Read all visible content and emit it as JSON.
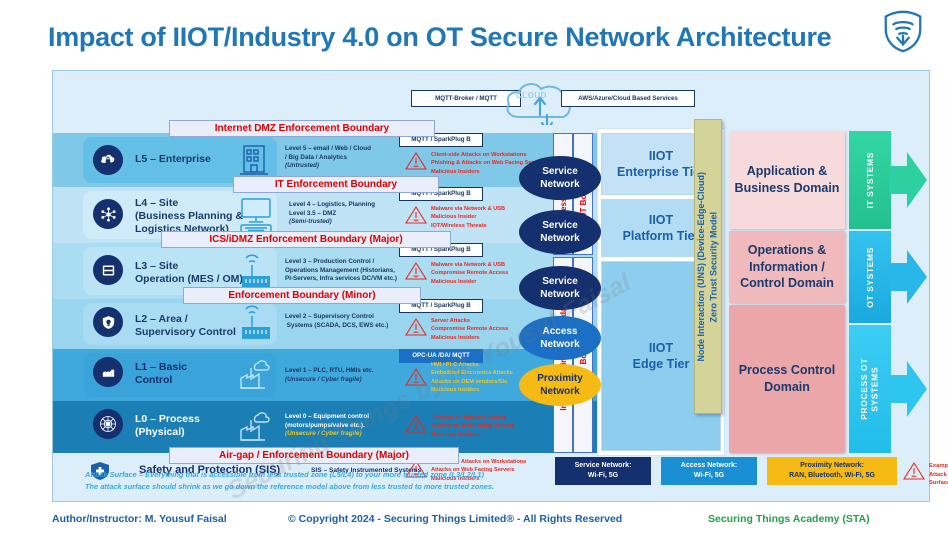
{
  "title": "Impact of IIOT/Industry 4.0 on OT Secure Network Architecture",
  "logo": "securing-things-shield-logo",
  "cloud": {
    "left_box": "MQTT-Broker /  MQTT",
    "center_label": "CLOUD",
    "right_box": "AWS/Azure/Cloud Based Services"
  },
  "boundaries": {
    "internet_dmz": "Internet DMZ Enforcement Boundary",
    "it": "IT Enforcement Boundary",
    "ics_idmz": "ICS/iDMZ Enforcement Boundary (Major)",
    "minor": "Enforcement Boundary (Minor)",
    "airgap": "Air-gap / Enforcement Boundary (Major)"
  },
  "levels": [
    {
      "id": "l5",
      "icon": "cloud-lock-icon",
      "device_icon": "enterprise-building-icon",
      "label": "L5 – Enterprise",
      "desc_lines": [
        "Level 5 – email / Web / Cloud",
        "/ Big Data / Analytics"
      ],
      "trust": "(Untrusted)",
      "protocol": "MQTT / SparkPlug B",
      "attacks": [
        "Client-side Attacks on Workstations",
        "Phishing & Attacks on Web Facing Servers",
        "Malicious Insiders"
      ],
      "network": "Service\nNetwork"
    },
    {
      "id": "l4",
      "icon": "network-nodes-icon",
      "device_icon": "desktop-computer-icon",
      "label": "L4 – Site\n(Business Planning &\nLogistics Network)",
      "desc_lines": [
        "Level 4 – Logistics, Planning",
        "Level 3.5 – DMZ"
      ],
      "trust": "(Semi-trusted)",
      "protocol": "MQTT / SparkPlug B",
      "attacks": [
        "Malware via Network & USB",
        "Malicious Insider",
        "IOT/Wireless Threats"
      ],
      "network": "Service\nNetwork"
    },
    {
      "id": "l3",
      "icon": "server-icon",
      "device_icon": "wireless-plant-icon",
      "label": "L3 – Site\nOperation (MES / OM)",
      "desc_lines": [
        "Level 3 – Production Control /",
        "Operations Management (Historians,",
        "PI-Servers, Infra services DC/VM etc.)"
      ],
      "trust": "",
      "protocol": "MQTT / SparkPlug B",
      "attacks": [
        "Malware via Network & USB",
        "Compromise Remote Access",
        "Malicious Insider"
      ],
      "network": "Service\nNetwork"
    },
    {
      "id": "l2",
      "icon": "shield-bulb-icon",
      "device_icon": "wireless-plant-icon",
      "label": "L2 – Area /\nSupervisory Control",
      "desc_lines": [
        "Level 2 – Supervisory Control",
        "Systems (SCADA, DCS, EWS etc.)"
      ],
      "trust": "",
      "protocol": "MQTT / SparkPlug B",
      "attacks": [
        "Server Attacks",
        "Compromise Remote Access",
        "Malicious Insiders"
      ],
      "network": "Access\nNetwork"
    },
    {
      "id": "l1",
      "icon": "plc-controller-icon",
      "device_icon": "factory-icon",
      "label": "L1 – Basic\nControl",
      "desc_lines": [
        "Level 1 – PLC, RTU, HMIs etc."
      ],
      "trust": "(Unsecure / Cyber fragile)",
      "protocol": "OPC-UA /DA/ MQTT",
      "attacks": [
        "HMI / PLC Attacks",
        "Embedded Electronics Attacks",
        "Attacks on OEM vendors/SIs",
        "Malicious Insiders"
      ],
      "network": "Proximity\nNetwork"
    },
    {
      "id": "l0",
      "icon": "process-brain-icon",
      "device_icon": "factory-icon",
      "label": "L0 – Process\n(Physical)",
      "desc_lines": [
        "Level 0 – Equipment control",
        "(motors/pumps/valve etc.)."
      ],
      "trust": "(Unsecure / Cyber fragile)",
      "protocol": "",
      "attacks": [
        "Physical or Wireless Access",
        "Attacks on Web Facing Servers",
        "Malicious Insiders"
      ],
      "network": ""
    }
  ],
  "vertical_boundaries": {
    "wireless": "Wireless Boundary",
    "iot": "IOT Boundary",
    "industrial_wireless": "Industrial Wireless Boundary",
    "iiot": "IIOT Boundary"
  },
  "tiers": [
    {
      "label": "IIOT\nEnterprise Tier"
    },
    {
      "label": "IIOT\nPlatform Tier"
    },
    {
      "label": "IIOT\nEdge Tier"
    }
  ],
  "uns_strip": "Node Interaction (UNS) (Device-Edge-Cloud)\nZero Trust Security Model",
  "domains": [
    {
      "label": "Application &\nBusiness Domain"
    },
    {
      "label": "Operations &\nInformation /\nControl Domain"
    },
    {
      "label": "Process Control\nDomain"
    }
  ],
  "systems": [
    {
      "label": "IT SYSTEMS",
      "color": "#2ecfa0"
    },
    {
      "label": "OT SYSTEMS",
      "color": "#29b6e8"
    },
    {
      "label": "PROCESS OT\nSYSTEMS",
      "color": "#2ec6ef"
    }
  ],
  "sis_row": {
    "icon": "safety-shield-icon",
    "label": "Safety and Protection (SIS)",
    "abbrev": "SIS – Safety Instrumented Systems",
    "attacks": [
      "Client-side Attacks on Workstations",
      "Attacks on Web Facing Servers",
      "Malicious Insiders"
    ]
  },
  "attack_note": "Attack Surface = Everything that is accessible from  less trusted zone (L5/L4) to your more trusted zone (L3/L2/L1)\nThe attack surface should shrink as we go down the reference model above from less trusted to more trusted zones.",
  "legend": [
    {
      "label": "Service Network:\nWi-Fi, 5G",
      "bg": "#14306e",
      "fg": "#ffffff"
    },
    {
      "label": "Access Network:\nWi-Fi, 5G",
      "bg": "#1b8fd4",
      "fg": "#ffffff"
    },
    {
      "label": "Proximity Network:\nRAN, Bluetooth, Wi-Fi, 5G",
      "bg": "#f5ba14",
      "fg": "#15306e"
    },
    {
      "label": "Example\nAttack Surface",
      "bg": "#ffffff",
      "fg": "#e8281e",
      "icon": "warning-triangle-icon"
    }
  ],
  "footer": {
    "author": "Author/Instructor: M. Yousuf Faisal",
    "copyright": "© Copyright 2024 - Securing Things Limited® - All Rights Reserved",
    "academy": "Securing Things Academy (STA)"
  },
  "watermark": "Securing Things by M. Yousuf Faisal",
  "colors": {
    "title": "#1f77b8",
    "boundary_text": "#e00000",
    "attack_text": "#e8281e",
    "accent_blue": "#1b5fa8"
  }
}
